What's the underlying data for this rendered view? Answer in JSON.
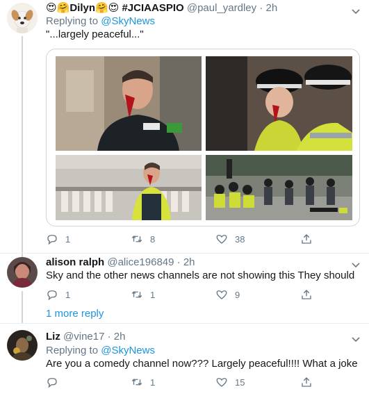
{
  "tweets": [
    {
      "display_name": "😍🤗Dilyn🤗😍 #JCIAASPIO",
      "handle": "@paul_yardley",
      "dot": "·",
      "time": "2h",
      "replying_prefix": "Replying to",
      "replying_to": "@SkyNews",
      "text": "\"...largely peaceful...\"",
      "counts": {
        "reply": "1",
        "retweet": "8",
        "like": "38"
      },
      "avatar_icon": "dog-avatar"
    },
    {
      "display_name": "alison ralph",
      "handle": "@alice196849",
      "dot": "·",
      "time": "2h",
      "text": "Sky and the other news channels are not showing this They should",
      "counts": {
        "reply": "1",
        "retweet": "1",
        "like": "9"
      },
      "more_replies": "1 more reply"
    },
    {
      "display_name": "Liz",
      "handle": "@vine17",
      "dot": "·",
      "time": "2h",
      "replying_prefix": "Replying to",
      "replying_to": "@SkyNews",
      "text": "Are you a comedy channel now??? Largely peaceful!!!! What a joke",
      "counts": {
        "reply": "",
        "retweet": "1",
        "like": "15"
      }
    }
  ],
  "icons": [
    "reply-icon",
    "retweet-icon",
    "like-icon",
    "share-icon",
    "chevron-down-icon"
  ],
  "colors": {
    "link": "#1b95e0",
    "muted": "#657786",
    "divider": "#e6ecf0",
    "rail": "#ccd6dd"
  }
}
